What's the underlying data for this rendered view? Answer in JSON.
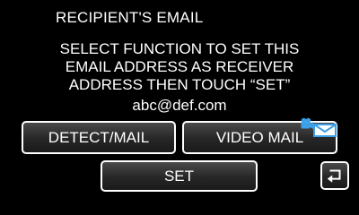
{
  "dialog": {
    "title": "RECIPIENT'S EMAIL",
    "message_lines": [
      "SELECT FUNCTION TO SET THIS",
      "EMAIL ADDRESS AS RECEIVER",
      "ADDRESS THEN TOUCH “SET”"
    ],
    "email": "abc@def.com"
  },
  "buttons": {
    "detect_mail": "DETECT/MAIL",
    "video_mail": "VIDEO MAIL",
    "set": "SET"
  },
  "icons": {
    "video_mail_badge": "video-mail-icon",
    "back": "return-arrow-icon"
  },
  "colors": {
    "background": "#000000",
    "text": "#ffffff",
    "button_border": "#ffffff",
    "icon_accent": "#3aa0e8"
  }
}
